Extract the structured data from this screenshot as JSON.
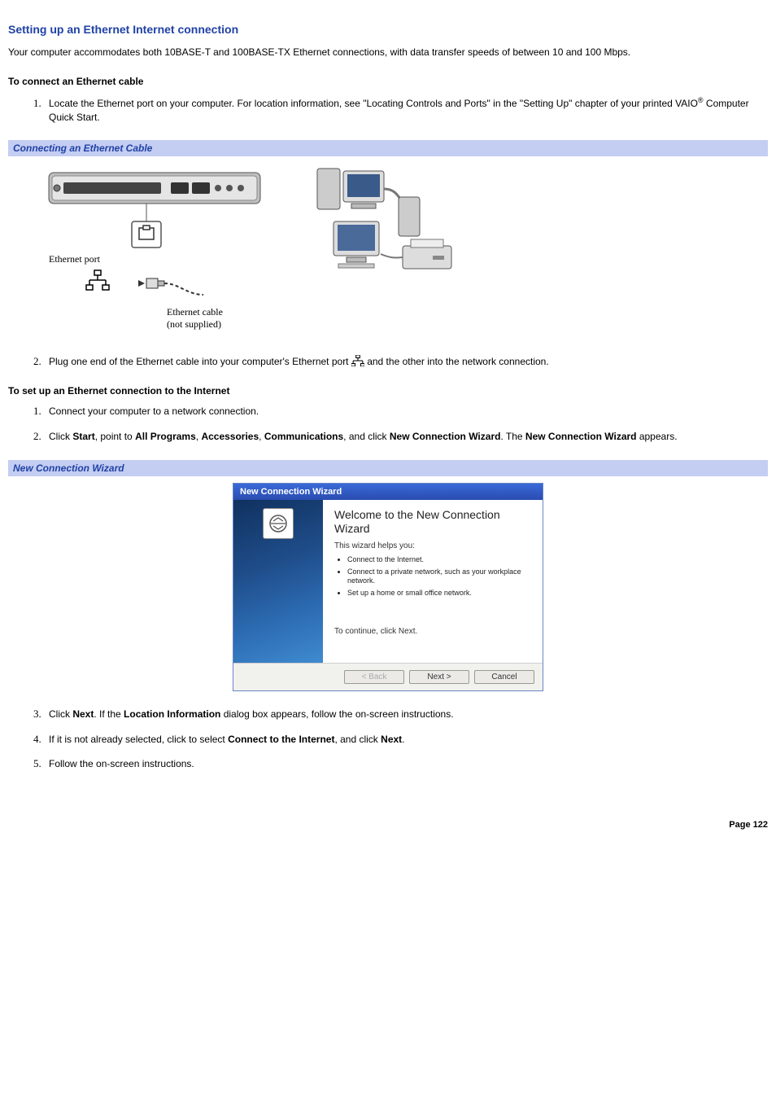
{
  "title": "Setting up an Ethernet Internet connection",
  "intro": "Your computer accommodates both 10BASE-T and 100BASE-TX Ethernet connections, with data transfer speeds of between 10 and 100 Mbps.",
  "sub1": "To connect an Ethernet cable",
  "step_a1_pre": "Locate the Ethernet port on your computer. For location information, see \"Locating Controls and Ports\" in the \"Setting Up\" chapter of your printed VAIO",
  "step_a1_post": " Computer Quick Start.",
  "reg": "®",
  "bar1": "Connecting an Ethernet Cable",
  "fig": {
    "port_label": "Ethernet port",
    "cable_label1": "Ethernet cable",
    "cable_label2": "(not supplied)"
  },
  "step_a2_pre": "Plug one end of the Ethernet cable into your computer's Ethernet port ",
  "step_a2_post": "and the other into the network connection.",
  "sub2": "To set up an Ethernet connection to the Internet",
  "step_b1": "Connect your computer to a network connection.",
  "step_b2": {
    "t0": "Click ",
    "b0": "Start",
    "t1": ", point to ",
    "b1": "All Programs",
    "t2": ", ",
    "b2": "Accessories",
    "t3": ", ",
    "b3": "Communications",
    "t4": ", and click ",
    "b4": "New Connection Wizard",
    "t5": ". The ",
    "b5": "New Connection Wizard",
    "t6": " appears."
  },
  "bar2": "New Connection Wizard",
  "wizard": {
    "title": "New Connection Wizard",
    "heading": "Welcome to the New Connection Wizard",
    "sub": "This wizard helps you:",
    "bullets": [
      "Connect to the Internet.",
      "Connect to a private network, such as your workplace network.",
      "Set up a home or small office network."
    ],
    "continue": "To continue, click Next.",
    "btn_back": "< Back",
    "btn_next": "Next >",
    "btn_cancel": "Cancel"
  },
  "step_b3": {
    "t0": "Click ",
    "b0": "Next",
    "t1": ". If the ",
    "b1": "Location Information",
    "t2": " dialog box appears, follow the on-screen instructions."
  },
  "step_b4": {
    "t0": "If it is not already selected, click to select ",
    "b0": "Connect to the Internet",
    "t1": ", and click ",
    "b1": "Next",
    "t2": "."
  },
  "step_b5": "Follow the on-screen instructions.",
  "page": "Page 122"
}
